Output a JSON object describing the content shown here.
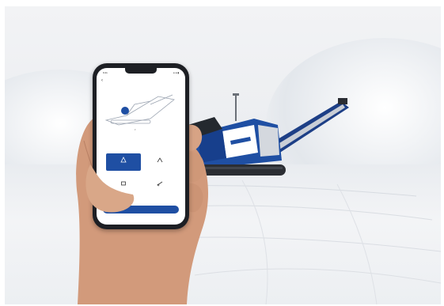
{
  "scene": {
    "brand_color": "#1f4fa3",
    "background_color": "#eceef1",
    "machine": "mobile-crusher-blue",
    "objects": [
      "smartphone",
      "hand",
      "mobile-jaw-crusher",
      "gravel-pit"
    ]
  },
  "app": {
    "time": "9:41",
    "signal": "● ● ▮",
    "title": "",
    "back_label": "‹",
    "section_label": "",
    "options": [
      {
        "label": "",
        "icon": "crusher-icon",
        "active": true
      },
      {
        "label": "",
        "icon": "screen-icon",
        "active": false
      },
      {
        "label": "",
        "icon": "feed-icon",
        "active": false
      },
      {
        "label": "",
        "icon": "conveyor-icon",
        "active": false
      }
    ],
    "cta_label": ""
  }
}
